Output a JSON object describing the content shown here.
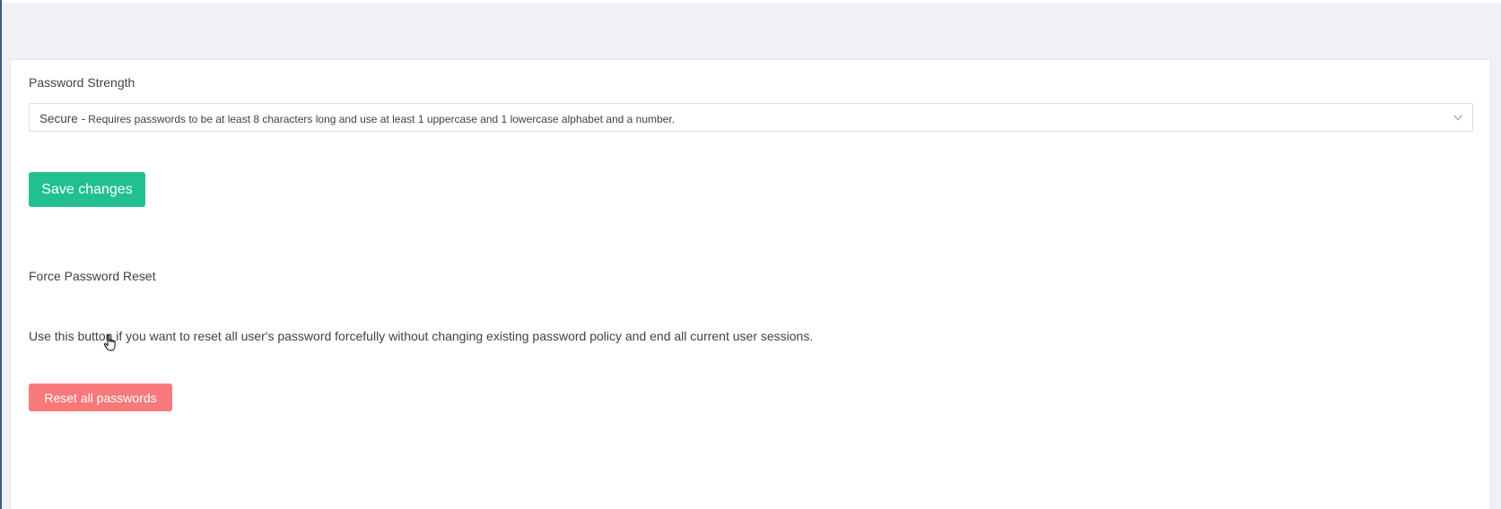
{
  "password_strength": {
    "label": "Password Strength",
    "selected": {
      "name": "Secure",
      "separator": "-",
      "description": "Requires passwords to be at least 8 characters long and use at least 1 uppercase and 1 lowercase alphabet and a number."
    },
    "chevron_icon": "chevron-down-icon",
    "save_label": "Save changes"
  },
  "force_reset": {
    "title": "Force Password Reset",
    "description": "Use this button if you want to reset all user's password forcefully without changing existing password policy and end all current user sessions.",
    "button_label": "Reset all passwords"
  },
  "colors": {
    "save_button": "#22c08e",
    "reset_button": "#f87979",
    "page_background": "#eff1f5"
  }
}
